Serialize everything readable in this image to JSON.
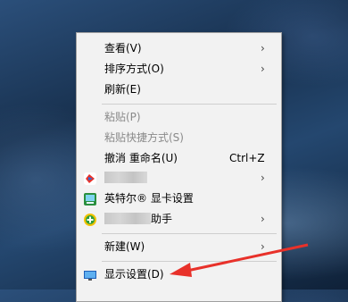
{
  "context_menu": {
    "items": [
      {
        "label": "查看(V)",
        "submenu": true
      },
      {
        "label": "排序方式(O)",
        "submenu": true
      },
      {
        "label": "刷新(E)"
      },
      {
        "label": "粘贴(P)",
        "disabled": true
      },
      {
        "label": "粘贴快捷方式(S)",
        "disabled": true
      },
      {
        "label": "撤消 重命名(U)",
        "shortcut": "Ctrl+Z"
      },
      {
        "label": "",
        "submenu": true
      },
      {
        "label": "英特尔® 显卡设置"
      },
      {
        "label": "助手",
        "submenu": true
      },
      {
        "label": "新建(W)",
        "submenu": true
      },
      {
        "label": "显示设置(D)"
      }
    ],
    "submenu_arrow": "›"
  },
  "icons": {
    "item7": "app-icon-blurred",
    "item8": "intel-graphics-icon",
    "item9": "assistant-plus-icon",
    "display": "display-settings-icon"
  },
  "annotation": {
    "color": "#e8312a"
  }
}
